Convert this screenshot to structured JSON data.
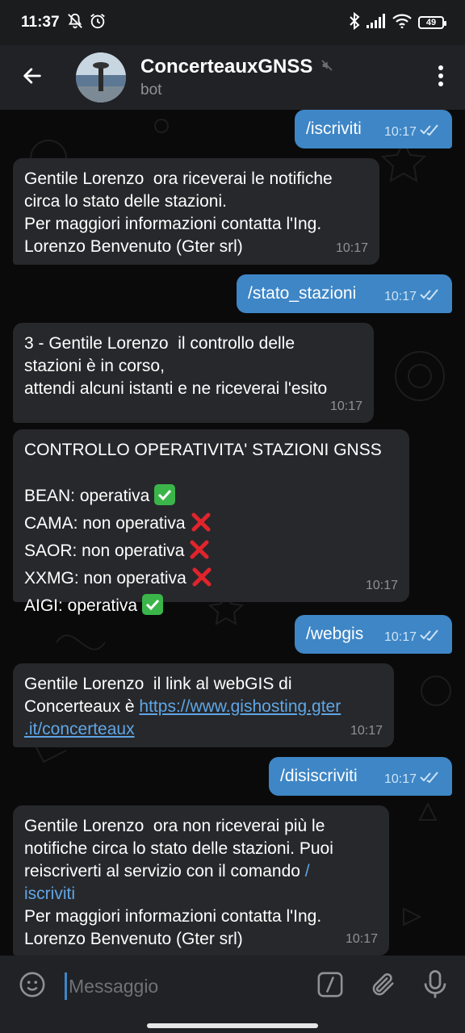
{
  "status_bar": {
    "time": "11:37",
    "battery": "49",
    "icons_left": [
      "mute-notifications-icon",
      "alarm-icon"
    ],
    "icons_right": [
      "bluetooth-icon",
      "signal-icon",
      "wifi-icon",
      "battery-icon"
    ]
  },
  "header": {
    "title": "ConcerteauxGNSS",
    "subtitle": "bot",
    "muted_icon": "muted-speaker-icon",
    "back_icon": "arrow-left-icon",
    "menu_icon": "more-vertical-icon"
  },
  "messages": [
    {
      "dir": "out",
      "text": "/iscriviti",
      "time": "10:17",
      "read": true
    },
    {
      "dir": "in",
      "text": "Gentile Lorenzo  ora riceverai le notifiche\ncirca lo stato delle stazioni.\nPer maggiori informazioni contatta l'Ing.\nLorenzo Benvenuto (Gter srl)",
      "time": "10:17"
    },
    {
      "dir": "out",
      "text": "/stato_stazioni",
      "time": "10:17",
      "read": true
    },
    {
      "dir": "in",
      "text": "3 - Gentile Lorenzo  il controllo delle\nstazioni è in corso,\nattendi alcuni istanti e ne riceverai l'esito",
      "time": "10:17"
    },
    {
      "dir": "in",
      "title": "CONTROLLO OPERATIVITA' STAZIONI GNSS",
      "time": "10:17",
      "stations": [
        {
          "line": "BEAN:  operativa",
          "ok": true
        },
        {
          "line": "CAMA:  non operativa",
          "ok": false
        },
        {
          "line": "SAOR:  non operativa",
          "ok": false
        },
        {
          "line": "XXMG:  non operativa",
          "ok": false
        },
        {
          "line": "AIGI:  operativa",
          "ok": true
        }
      ]
    },
    {
      "dir": "out",
      "text": "/webgis",
      "time": "10:17",
      "read": true
    },
    {
      "dir": "in",
      "text_before": "Gentile Lorenzo  il link al webGIS di\nConcerteaux è ",
      "link_part1": "https://www.gishosting.gter",
      "link_part2": ".it/concerteaux",
      "time": "10:17"
    },
    {
      "dir": "out",
      "text": "/disiscriviti",
      "time": "10:17",
      "read": true
    },
    {
      "dir": "in",
      "text_before": "Gentile Lorenzo  ora non riceverai più le\nnotifiche circa lo stato delle stazioni. Puoi\nreiscriverti al servizio con il comando ",
      "cmd_part1": "/",
      "cmd_part2": "iscriviti",
      "text_after": "\nPer maggiori informazioni contatta l'Ing.\nLorenzo Benvenuto (Gter srl)",
      "time": "10:17"
    }
  ],
  "composer": {
    "placeholder": "Messaggio",
    "emoji_icon": "emoji-smile-icon",
    "bot_command_icon": "slash-command-icon",
    "attach_icon": "paperclip-icon",
    "mic_icon": "microphone-icon"
  },
  "colors": {
    "outgoing_bubble": "#3e86c6",
    "incoming_bubble": "#27282b",
    "header_bg": "#212226",
    "link": "#5fa6e6"
  }
}
